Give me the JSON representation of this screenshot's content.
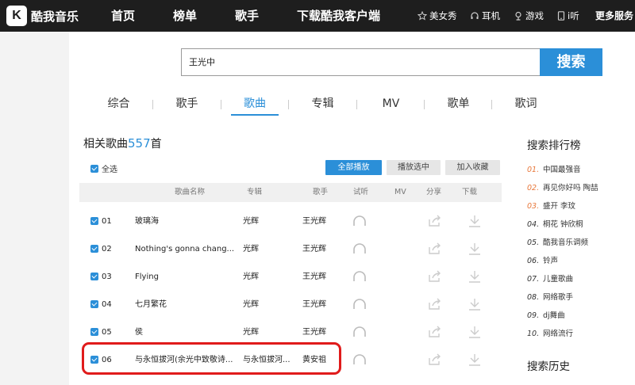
{
  "logo": {
    "mark": "K",
    "text": "酷我音乐"
  },
  "nav": {
    "items": [
      "首页",
      "榜单",
      "歌手",
      "下载酷我客户端"
    ],
    "right": [
      {
        "label": "美女秀",
        "icon": "star-icon"
      },
      {
        "label": "耳机",
        "icon": "headphones-icon"
      },
      {
        "label": "游戏",
        "icon": "pin-icon"
      },
      {
        "label": "i听",
        "icon": "phone-icon"
      }
    ],
    "more": "更多服务"
  },
  "search": {
    "query": "王光中",
    "button": "搜索"
  },
  "tabs": {
    "items": [
      "综合",
      "歌手",
      "歌曲",
      "专辑",
      "MV",
      "歌单",
      "歌词"
    ],
    "active": "歌曲"
  },
  "results": {
    "prefix": "相关歌曲",
    "count": "557",
    "suffix": "首"
  },
  "actions": {
    "select_all": "全选",
    "play_all": "全部播放",
    "play_selected": "播放选中",
    "add_favorite": "加入收藏"
  },
  "table": {
    "headers": {
      "name": "歌曲名称",
      "album": "专辑",
      "artist": "歌手",
      "listen": "试听",
      "mv": "MV",
      "share": "分享",
      "download": "下载"
    },
    "rows": [
      {
        "num": "01",
        "name": "玻璃海",
        "album": "光辉",
        "artist": "王光辉"
      },
      {
        "num": "02",
        "name": "Nothing's gonna chang...",
        "album": "光辉",
        "artist": "王光辉"
      },
      {
        "num": "03",
        "name": "Flying",
        "album": "光辉",
        "artist": "王光辉"
      },
      {
        "num": "04",
        "name": "七月繁花",
        "album": "光辉",
        "artist": "王光辉"
      },
      {
        "num": "05",
        "name": "侯",
        "album": "光辉",
        "artist": "王光辉"
      },
      {
        "num": "06",
        "name": "与永恒拔河(余光中致敬诗...",
        "album": "与永恒拔河...",
        "artist": "黄安祖"
      }
    ]
  },
  "sidebar": {
    "rank_title": "搜索排行榜",
    "rank": [
      {
        "n": "01.",
        "text": "中国最强音"
      },
      {
        "n": "02.",
        "text": "再见你好吗 陶喆"
      },
      {
        "n": "03.",
        "text": "盛开 李玟"
      },
      {
        "n": "04.",
        "text": "桐花 钟欣桐"
      },
      {
        "n": "05.",
        "text": "酷我音乐调频"
      },
      {
        "n": "06.",
        "text": "铃声"
      },
      {
        "n": "07.",
        "text": "儿童歌曲"
      },
      {
        "n": "08.",
        "text": "网络歌手"
      },
      {
        "n": "09.",
        "text": "dj舞曲"
      },
      {
        "n": "10.",
        "text": "网络流行"
      }
    ],
    "history_title": "搜索历史"
  },
  "colors": {
    "accent": "#2b8fd8",
    "topbar": "#1e1e1e",
    "hot_rank": "#e8773a",
    "highlight": "#e01b1b"
  }
}
